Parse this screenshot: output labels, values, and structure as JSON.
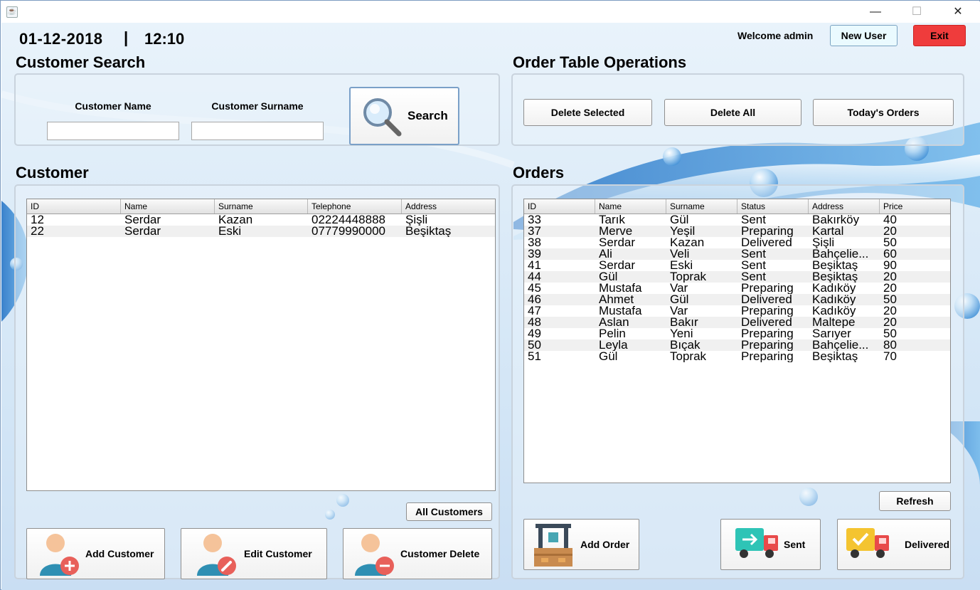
{
  "window": {
    "minimize": "—",
    "maximize": "☐",
    "close": "✕"
  },
  "header": {
    "date": "01-12-2018",
    "separator": "|",
    "time": "12:10",
    "welcome": "Welcome admin",
    "new_user": "New User",
    "exit": "Exit"
  },
  "customer_search": {
    "title": "Customer Search",
    "name_label": "Customer Name",
    "surname_label": "Customer Surname",
    "name_value": "",
    "surname_value": "",
    "search_label": "Search"
  },
  "order_ops": {
    "title": "Order Table Operations",
    "delete_selected": "Delete Selected",
    "delete_all": "Delete All",
    "todays_orders": "Today's Orders"
  },
  "customer": {
    "title": "Customer",
    "columns": [
      "ID",
      "Name",
      "Surname",
      "Telephone",
      "Address"
    ],
    "rows": [
      [
        "12",
        "Serdar",
        "Kazan",
        "02224448888",
        "Şişli"
      ],
      [
        "22",
        "Serdar",
        "Eski",
        "07779990000",
        "Beşiktaş"
      ]
    ],
    "all_customers": "All Customers",
    "add_customer": "Add Customer",
    "edit_customer": "Edit Customer",
    "delete_customer": "Customer Delete"
  },
  "orders": {
    "title": "Orders",
    "columns": [
      "ID",
      "Name",
      "Surname",
      "Status",
      "Address",
      "Price"
    ],
    "rows": [
      [
        "33",
        "Tarık",
        "Gül",
        "Sent",
        "Bakırköy",
        "40"
      ],
      [
        "37",
        "Merve",
        "Yeşil",
        "Preparing",
        "Kartal",
        "20"
      ],
      [
        "38",
        "Serdar",
        "Kazan",
        "Delivered",
        "Şişli",
        "50"
      ],
      [
        "39",
        "Ali",
        "Veli",
        "Sent",
        "Bahçelie...",
        "60"
      ],
      [
        "41",
        "Serdar",
        "Eski",
        "Sent",
        "Beşiktaş",
        "90"
      ],
      [
        "44",
        "Gül",
        "Toprak",
        "Sent",
        "Beşiktaş",
        "20"
      ],
      [
        "45",
        "Mustafa",
        "Var",
        "Preparing",
        "Kadıköy",
        "20"
      ],
      [
        "46",
        "Ahmet",
        "Gül",
        "Delivered",
        "Kadıköy",
        "50"
      ],
      [
        "47",
        "Mustafa",
        "Var",
        "Preparing",
        "Kadıköy",
        "20"
      ],
      [
        "48",
        "Aslan",
        "Bakır",
        "Delivered",
        "Maltepe",
        "20"
      ],
      [
        "49",
        "Pelin",
        "Yeni",
        "Preparing",
        "Sarıyer",
        "50"
      ],
      [
        "50",
        "Leyla",
        "Bıçak",
        "Preparing",
        "Bahçelie...",
        "80"
      ],
      [
        "51",
        "Gül",
        "Toprak",
        "Preparing",
        "Beşiktaş",
        "70"
      ]
    ],
    "refresh": "Refresh",
    "add_order": "Add Order",
    "sent": "Sent",
    "delivered": "Delivered"
  },
  "colors": {
    "exit_red": "#ef3c3c",
    "accent_blue": "#3f8fd6"
  }
}
